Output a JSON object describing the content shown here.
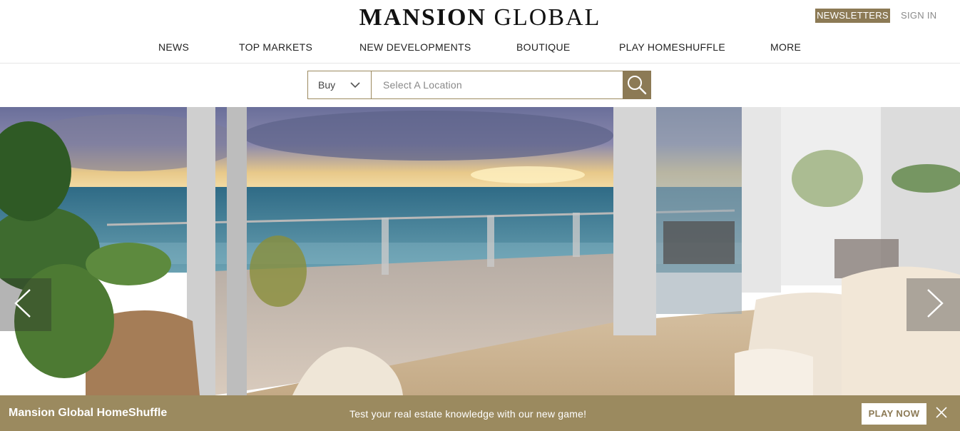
{
  "brand": {
    "name_bold": "MANSION",
    "name_light": "GLOBAL"
  },
  "top_links": {
    "newsletters": "NEWSLETTERS",
    "sign_in": "SIGN IN"
  },
  "nav": [
    {
      "label": "NEWS"
    },
    {
      "label": "TOP MARKETS"
    },
    {
      "label": "NEW DEVELOPMENTS"
    },
    {
      "label": "BOUTIQUE"
    },
    {
      "label": "PLAY HOMESHUFFLE"
    },
    {
      "label": "MORE"
    }
  ],
  "search": {
    "type_value": "Buy",
    "location_placeholder": "Select A Location",
    "icons": {
      "dropdown": "chevron-down-icon",
      "submit": "search-icon"
    }
  },
  "hero": {
    "icons": {
      "prev": "chevron-left-icon",
      "next": "chevron-right-icon"
    }
  },
  "promo": {
    "title": "Mansion Global HomeShuffle",
    "text": "Test your real estate knowledge with our new game!",
    "button": "PLAY NOW",
    "close_icon": "close-icon"
  },
  "colors": {
    "accent": "#8c7a55",
    "promo_bg": "#9b8a5f"
  }
}
